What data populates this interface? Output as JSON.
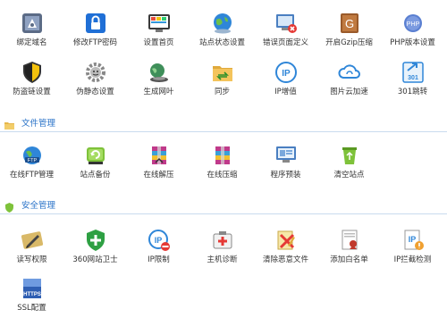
{
  "row1": [
    {
      "label": "绑定域名",
      "icon": "bind-domain-icon"
    },
    {
      "label": "修改FTP密码",
      "icon": "ftp-password-icon"
    },
    {
      "label": "设置首页",
      "icon": "homepage-icon"
    },
    {
      "label": "站点状态设置",
      "icon": "globe-status-icon"
    },
    {
      "label": "错误页面定义",
      "icon": "error-page-icon"
    },
    {
      "label": "开启Gzip压缩",
      "icon": "gzip-icon"
    },
    {
      "label": "PHP版本设置",
      "icon": "php-version-icon"
    }
  ],
  "row2": [
    {
      "label": "防盗链设置",
      "icon": "hotlink-shield-icon"
    },
    {
      "label": "伪静态设置",
      "icon": "rewrite-gear-icon"
    },
    {
      "label": "生成网叶",
      "icon": "generate-page-icon"
    },
    {
      "label": "同步",
      "icon": "sync-folder-icon"
    },
    {
      "label": "IP增值",
      "icon": "ip-addon-icon"
    },
    {
      "label": "图片云加速",
      "icon": "cloud-accelerate-icon"
    },
    {
      "label": "301跳转",
      "icon": "redirect-301-icon"
    }
  ],
  "sections": {
    "files": {
      "title": "文件管理",
      "icon": "folder-icon"
    },
    "security": {
      "title": "安全管理",
      "icon": "security-shield-icon"
    }
  },
  "files_items": [
    {
      "label": "在线FTP管理",
      "icon": "online-ftp-icon"
    },
    {
      "label": "站点备份",
      "icon": "backup-icon"
    },
    {
      "label": "在线解压",
      "icon": "unzip-icon"
    },
    {
      "label": "在线压缩",
      "icon": "zip-icon"
    },
    {
      "label": "程序预装",
      "icon": "program-install-icon"
    },
    {
      "label": "清空站点",
      "icon": "recycle-bin-icon"
    }
  ],
  "security_items": [
    {
      "label": "读写权限",
      "icon": "permission-pen-icon"
    },
    {
      "label": "360网站卫士",
      "icon": "guard-360-icon"
    },
    {
      "label": "IP限制",
      "icon": "ip-restrict-icon"
    },
    {
      "label": "主机诊断",
      "icon": "host-diagnosis-icon"
    },
    {
      "label": "清除恶意文件",
      "icon": "clean-malware-icon"
    },
    {
      "label": "添加白名单",
      "icon": "whitelist-icon"
    },
    {
      "label": "IP拦截检测",
      "icon": "ip-block-detect-icon"
    },
    {
      "label": "SSL配置",
      "icon": "ssl-config-icon"
    }
  ],
  "colors": {
    "accent": "#2a73c8",
    "divider": "#c9dbee"
  }
}
